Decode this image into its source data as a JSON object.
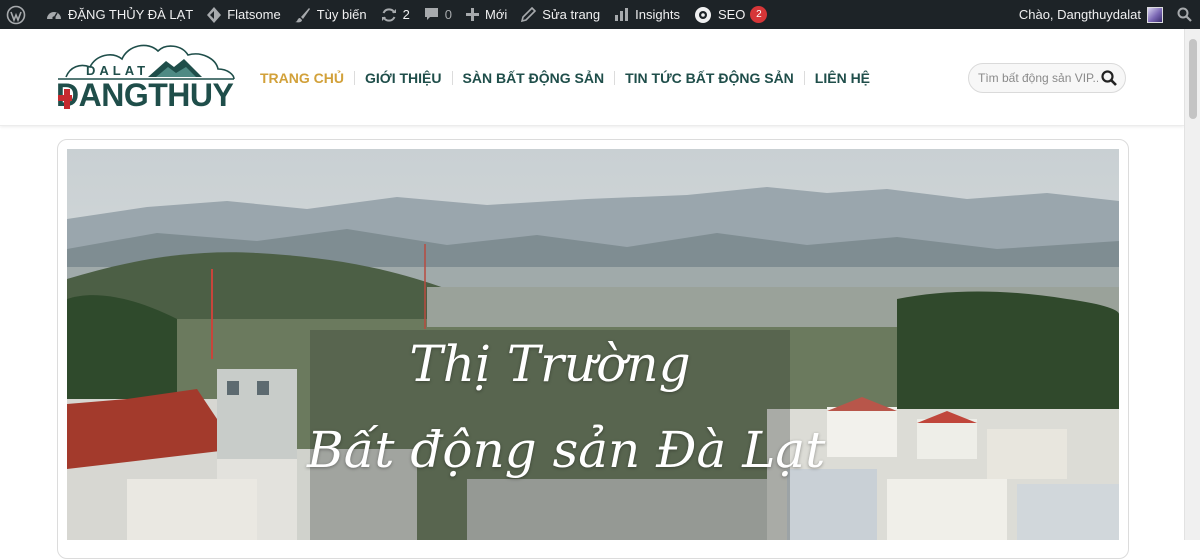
{
  "admin_bar": {
    "site_name": "ĐẶNG THỦY ĐÀ LẠT",
    "theme": "Flatsome",
    "customize": "Tùy biến",
    "updates_count": "2",
    "comments_count": "0",
    "new": "Mới",
    "edit_page": "Sửa trang",
    "insights": "Insights",
    "seo": "SEO",
    "seo_badge": "2",
    "greeting": "Chào, Dangthuydalat"
  },
  "logo": {
    "top_text": "DALAT",
    "main_text": "DANGTHUY"
  },
  "nav": {
    "items": [
      {
        "label": "TRANG CHỦ",
        "active": true
      },
      {
        "label": "GIỚI THIỆU",
        "active": false
      },
      {
        "label": "SÀN BẤT ĐỘNG SẢN",
        "active": false
      },
      {
        "label": "TIN TỨC BẤT ĐỘNG SẢN",
        "active": false
      },
      {
        "label": "LIÊN HỆ",
        "active": false
      }
    ]
  },
  "search": {
    "placeholder": "Tìm bất động sản VIP..."
  },
  "hero": {
    "line1": "Thị Trường",
    "line2": "Bất động sản Đà Lạt"
  },
  "colors": {
    "admin_bg": "#1d2327",
    "brand_green": "#1f4e4a",
    "nav_active": "#d2a13a",
    "logo_red": "#c62a2f",
    "badge_red": "#d63638"
  },
  "icons": [
    "wordpress-icon",
    "dashboard-icon",
    "flatsome-icon",
    "brush-icon",
    "updates-icon",
    "comment-icon",
    "plus-icon",
    "pencil-icon",
    "insights-icon",
    "seo-icon",
    "search-icon"
  ]
}
